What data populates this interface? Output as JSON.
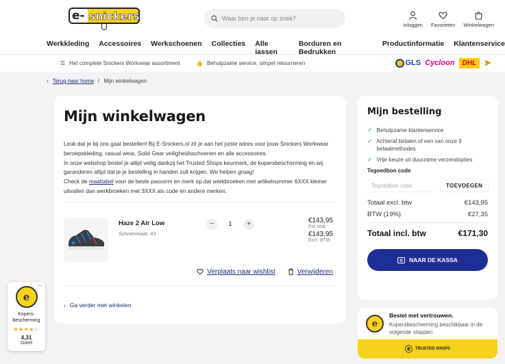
{
  "header": {
    "logo_text": "e-snickers",
    "search_placeholder": "Waar ben je naar op zoek?",
    "icons": [
      {
        "icon": "user-icon",
        "label": "Inloggen"
      },
      {
        "icon": "heart-icon",
        "label": "Favorieten"
      },
      {
        "icon": "bag-icon",
        "label": "Winkelwagen"
      }
    ],
    "nav": [
      "Werkkleding",
      "Accessoires",
      "Werkschoenen",
      "Collecties",
      "Alle jassen",
      "Borduren en Bedrukken",
      "Productinformatie",
      "Klantenservice"
    ]
  },
  "usp": {
    "assortment": "Het complete Snickers Workwear assortiment",
    "service": "Behulpzame service, simpel retourneren"
  },
  "carriers": {
    "gls": "GLS",
    "cycloon": "Cycloon",
    "dhl": "DHL"
  },
  "breadcrumb": {
    "back": "Terug naar home",
    "current": "Mijn winkelwagen"
  },
  "cart": {
    "title": "Mijn winkelwagen",
    "intro_1": "Leuk dat je bij ons gaat bestellen! Bij E-Snickers.nl zit je aan het juiste adres voor jouw Snickers Workwear beroepskleding, casual wear, Solid Gear veiligheidsschoenen en alle accessoires.",
    "intro_2": "In onze webshop bestel je altijd veilig dankzij het Trusted Shops keurmerk, de kopersbescherming en wij garanderen altijd dat je je bestelling in handen zult krijgen. We helpen graag!",
    "intro_3a": "Check de ",
    "intro_link": "maattabel",
    "intro_3b": " voor de beste pasvorm en merk op dat werkbroeken met artikelnummer 6XXX kleiner uitvallen dan werkbroeken met 3XXX als code en andere merken.",
    "item": {
      "name": "Haze 2 Air Low",
      "size": "Schoenmaat: 43",
      "qty": "1",
      "price_each": "€143,95",
      "per_unit": "Per stuk",
      "price_excl": "€143,95",
      "excl_label": "Excl. BTW",
      "wishlist": "Verplaats naar wishlist",
      "remove": "Verwijderen"
    },
    "continue": "Ga verder met winkelen"
  },
  "order": {
    "title": "Mijn bestelling",
    "benefits": [
      "Behulpzame klantenservice",
      "Achteraf betalen of een van onze 9 betaalmethodes",
      "Vrije keuze uit duurzame verzendopties"
    ],
    "coupon_title": "Tegoedbon code",
    "coupon_placeholder": "Tegoedbon code",
    "coupon_button": "TOEVOEGEN",
    "subtotal_label": "Totaal excl. btw",
    "subtotal": "€143,95",
    "vat_label": "BTW (19%)",
    "vat": "€27,35",
    "total_label": "Totaal incl. btw",
    "total": "€171,30",
    "checkout": "NAAR DE KASSA"
  },
  "trust": {
    "title": "Bestel met vertrouwen.",
    "text": "Kopersbescherming beschikbaar in de volgende stappen",
    "bar": "TRUSTED SHOPS"
  },
  "badge": {
    "label": "Kopers-bescherming",
    "rating": 4.31,
    "score": "4,31",
    "grade": "Goed",
    "seal": "e"
  },
  "colors": {
    "accent": "#1f2e97",
    "brand_yellow": "#f7d21d",
    "link": "#1f2a72",
    "check": "#3aa34a"
  }
}
